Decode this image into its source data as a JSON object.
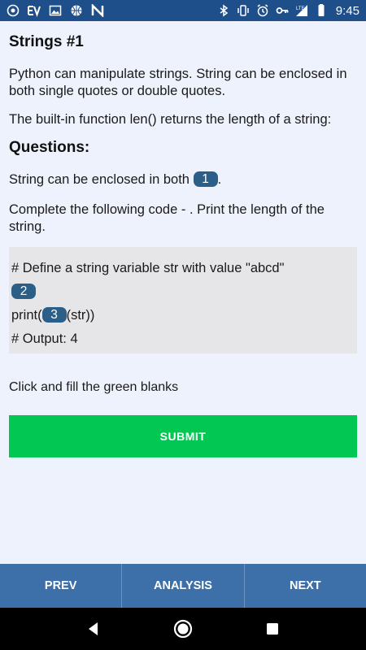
{
  "status_bar": {
    "left_icons": [
      "app-icon",
      "ev-icon",
      "image-icon",
      "basketball-icon",
      "n-icon"
    ],
    "right_icons": [
      "bluetooth-icon",
      "vibrate-icon",
      "alarm-icon",
      "key-icon",
      "lte-signal-icon",
      "battery-icon"
    ],
    "time": "9:45"
  },
  "page": {
    "title": "Strings #1",
    "intro_1": "Python can manipulate strings. String can be enclosed in both single quotes or double quotes.",
    "intro_2": "The built-in function len() returns the length of a string:",
    "questions_heading": "Questions:"
  },
  "question_1": {
    "before": "String can be enclosed in both ",
    "blank": "1",
    "after": "."
  },
  "question_2": {
    "text": "Complete the following code - . Print the length of the string."
  },
  "code": {
    "line1": "# Define a string variable str with value \"abcd\"",
    "blank_2": "2",
    "line3_before": "print(",
    "blank_3": "3",
    "line3_after": "(str))",
    "line4": "# Output: 4"
  },
  "hint": "Click and fill the green blanks",
  "submit_label": "SUBMIT",
  "nav": {
    "prev": "PREV",
    "analysis": "ANALYSIS",
    "next": "NEXT"
  },
  "colors": {
    "status_bar": "#1f4f8a",
    "background": "#eef2fd",
    "blank": "#2c5f88",
    "submit": "#02c853",
    "bottom_nav": "#3d6fa8"
  }
}
